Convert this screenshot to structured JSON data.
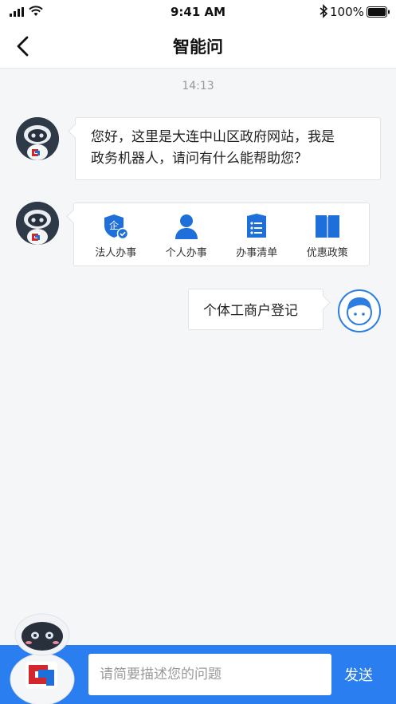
{
  "status_bar": {
    "time": "9:41 AM",
    "battery": "100%",
    "icons": [
      "signal-icon",
      "wifi-icon",
      "bluetooth-icon",
      "battery-icon"
    ]
  },
  "nav": {
    "title": "智能问",
    "back_icon": "chevron-left-icon"
  },
  "chat": {
    "timestamp": "14:13",
    "greeting": {
      "line1": "您好，这里是大连中山区政府网站，我是",
      "line2": "政务机器人，请问有什么能帮助您？"
    },
    "quick_menu": [
      {
        "label": "法人办事",
        "icon": "enterprise-shield-icon"
      },
      {
        "label": "个人办事",
        "icon": "person-icon"
      },
      {
        "label": "办事清单",
        "icon": "list-icon"
      },
      {
        "label": "优惠政策",
        "icon": "book-icon"
      }
    ],
    "user_message": "个体工商户登记"
  },
  "input_bar": {
    "placeholder": "请简要描述您的问题",
    "send_label": "发送"
  },
  "colors": {
    "accent": "#2a7ef0",
    "icon_blue": "#1e6fd9",
    "robot_dark": "#2f3a48"
  }
}
